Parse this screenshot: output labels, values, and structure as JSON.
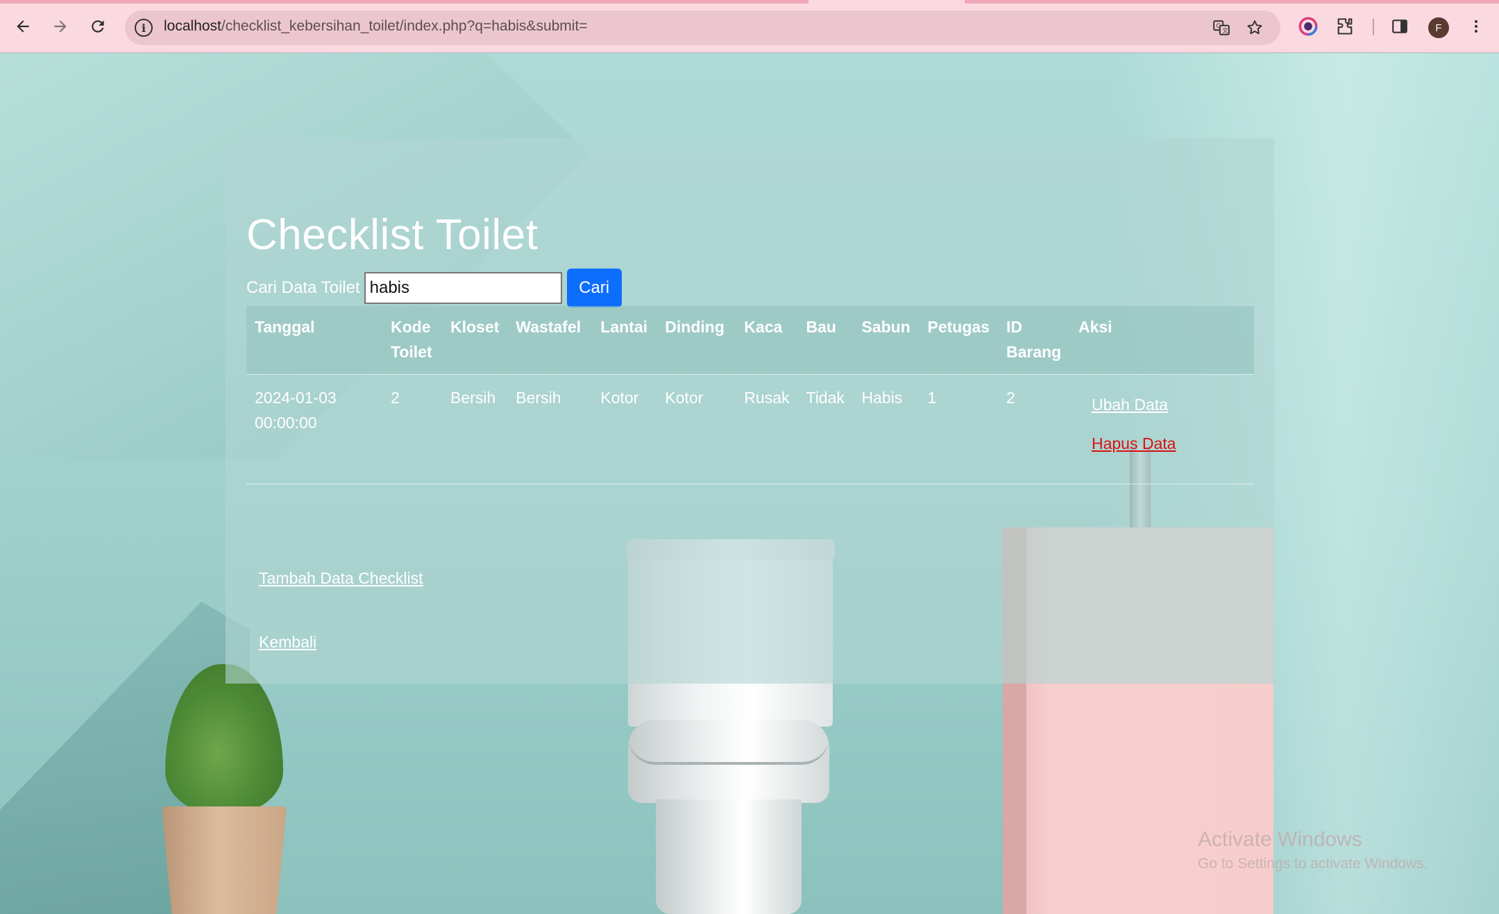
{
  "browser": {
    "url_host": "localhost",
    "url_path": "/checklist_kebersihan_toilet/index.php?q=habis&submit=",
    "profile_initial": "F",
    "icons": {
      "back": "arrow-left-icon",
      "forward": "arrow-right-icon",
      "reload": "reload-icon",
      "site_info": "info-icon",
      "translate": "translate-icon",
      "bookmark": "star-icon",
      "extension_color": "color-extension-icon",
      "extensions": "puzzle-icon",
      "side_panel": "side-panel-icon",
      "menu": "kebab-menu-icon"
    }
  },
  "page": {
    "title": "Checklist Toilet",
    "search": {
      "label": "Cari Data Toilet",
      "value": "habis",
      "button": "Cari"
    },
    "table": {
      "headers": [
        "Tanggal",
        "Kode Toilet",
        "Kloset",
        "Wastafel",
        "Lantai",
        "Dinding",
        "Kaca",
        "Bau",
        "Sabun",
        "Petugas",
        "ID Barang",
        "Aksi"
      ],
      "rows": [
        {
          "tanggal": "2024-01-03 00:00:00",
          "kode_toilet": "2",
          "kloset": "Bersih",
          "wastafel": "Bersih",
          "lantai": "Kotor",
          "dinding": "Kotor",
          "kaca": "Rusak",
          "bau": "Tidak",
          "sabun": "Habis",
          "petugas": "1",
          "id_barang": "2",
          "aksi_ubah": "Ubah Data",
          "aksi_hapus": "Hapus Data"
        }
      ]
    },
    "links": {
      "add": "Tambah Data Checklist",
      "back": "Kembali"
    }
  },
  "watermark": {
    "title": "Activate Windows",
    "subtitle": "Go to Settings to activate Windows."
  },
  "colors": {
    "chrome_bg": "#fbd9e1",
    "omnibox_bg": "#ecc6cf",
    "button_primary": "#0d6efd",
    "delete_link": "#d81212",
    "text_on_panel": "#ffffff"
  }
}
